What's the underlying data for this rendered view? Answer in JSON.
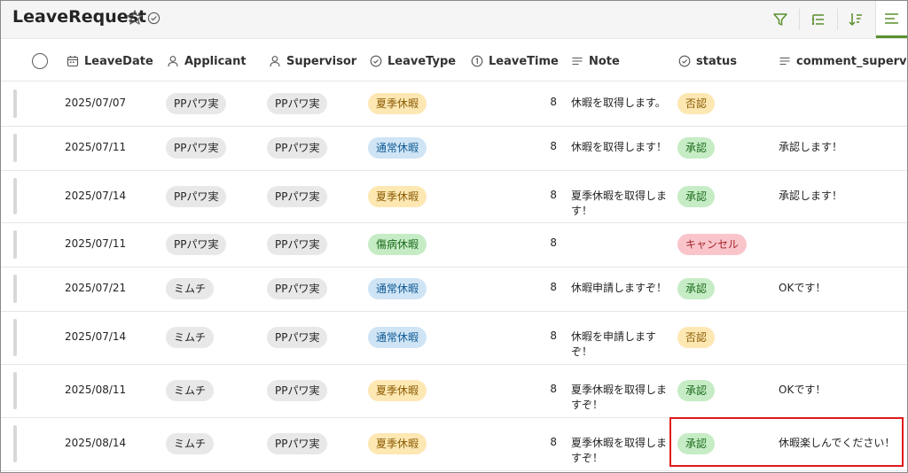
{
  "app": {
    "title": "LeaveRequest"
  },
  "toolbar": {
    "filter": "filter-icon",
    "group": "group-icon",
    "sort": "sort-icon",
    "view": "view-list-icon"
  },
  "columns": {
    "leave_date": "LeaveDate",
    "applicant": "Applicant",
    "supervisor": "Supervisor",
    "leave_type": "LeaveType",
    "leave_time": "LeaveTime",
    "note": "Note",
    "status": "status",
    "comment_supervisor": "comment_supervisor"
  },
  "rows": [
    {
      "date": "2025/07/07",
      "applicant": "PPパワ実",
      "supervisor": "PPパワ実",
      "type": "夏季休暇",
      "time": "8",
      "note": "休暇を取得します。",
      "status": "否認",
      "comment": ""
    },
    {
      "date": "2025/07/11",
      "applicant": "PPパワ実",
      "supervisor": "PPパワ実",
      "type": "通常休暇",
      "time": "8",
      "note": "休暇を取得します！",
      "status": "承認",
      "comment": "承認します！"
    },
    {
      "date": "2025/07/14",
      "applicant": "PPパワ実",
      "supervisor": "PPパワ実",
      "type": "夏季休暇",
      "time": "8",
      "note": "夏季休暇を取得します！",
      "status": "承認",
      "comment": "承認します！"
    },
    {
      "date": "2025/07/11",
      "applicant": "PPパワ実",
      "supervisor": "PPパワ実",
      "type": "傷病休暇",
      "time": "8",
      "note": "",
      "status": "キャンセル",
      "comment": ""
    },
    {
      "date": "2025/07/21",
      "applicant": "ミムチ",
      "supervisor": "PPパワ実",
      "type": "通常休暇",
      "time": "8",
      "note": "休暇申請しますぞ！",
      "status": "承認",
      "comment": "OKです！"
    },
    {
      "date": "2025/07/14",
      "applicant": "ミムチ",
      "supervisor": "PPパワ実",
      "type": "通常休暇",
      "time": "8",
      "note": "休暇を申請しますぞ！",
      "status": "否認",
      "comment": ""
    },
    {
      "date": "2025/08/11",
      "applicant": "ミムチ",
      "supervisor": "PPパワ実",
      "type": "夏季休暇",
      "time": "8",
      "note": "夏季休暇を取得しますぞ！",
      "status": "承認",
      "comment": "OKです！"
    },
    {
      "date": "2025/08/14",
      "applicant": "ミムチ",
      "supervisor": "PPパワ実",
      "type": "夏季休暇",
      "time": "8",
      "note": "夏季休暇を取得しますぞ！",
      "status": "承認",
      "comment": "休暇楽しんでください！"
    }
  ],
  "colors": {
    "accent": "#5a8f2d",
    "highlight": "#e0191b",
    "type_summer": "#fde7b3",
    "type_normal": "#cfe4f5",
    "type_sick": "#c6ecc6",
    "status_approved": "#c6ecc6",
    "status_rejected": "#fde7b3",
    "status_cancel": "#f9c5cb"
  }
}
